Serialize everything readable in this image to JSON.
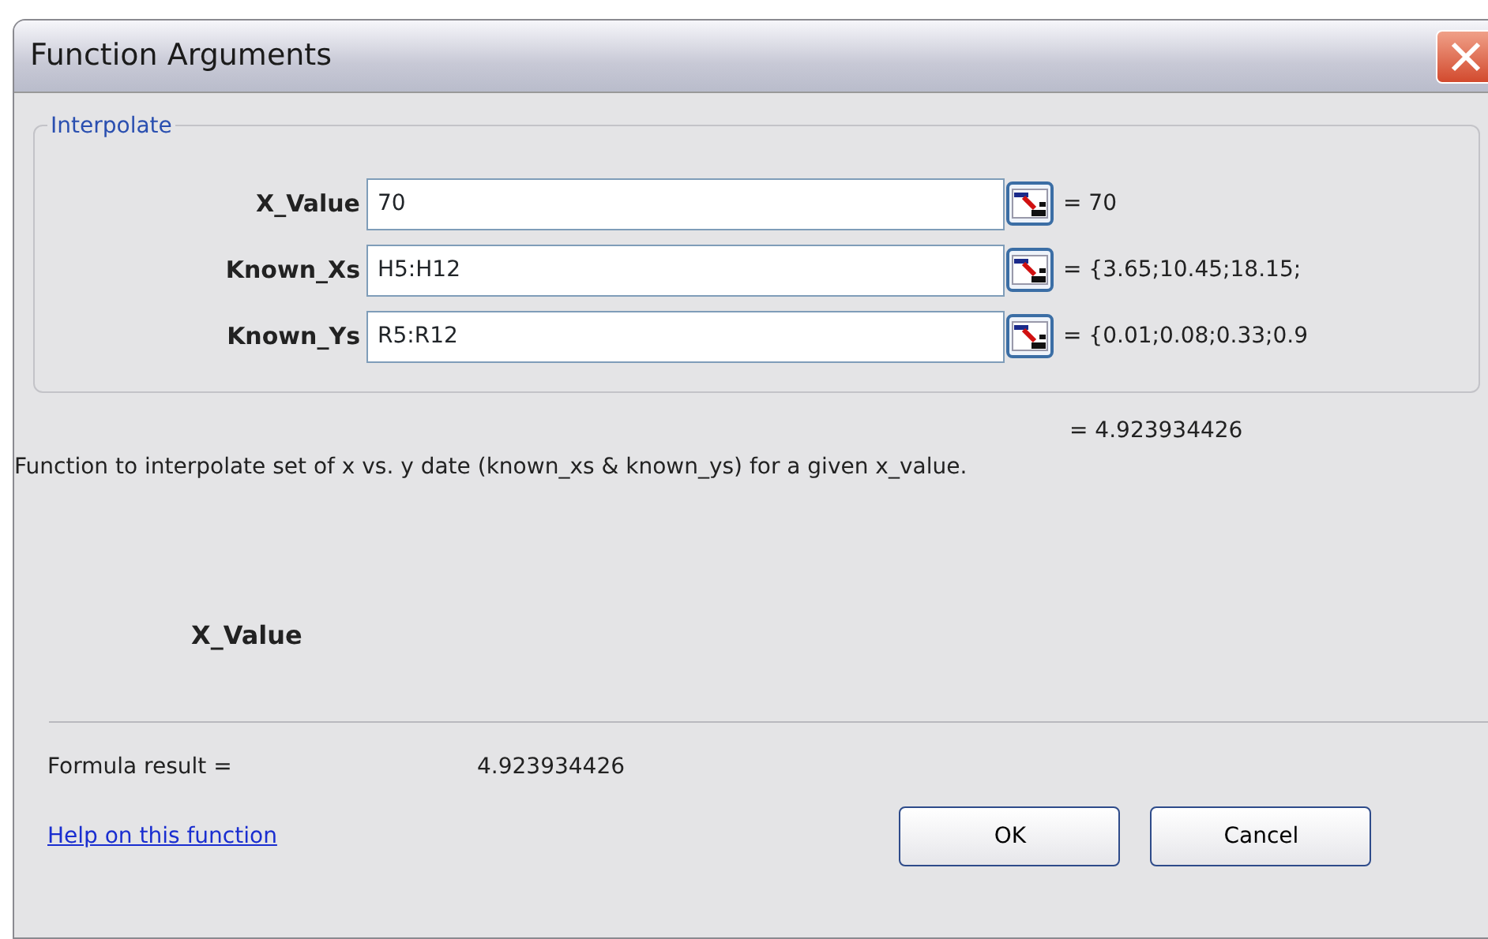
{
  "window": {
    "title": "Function Arguments"
  },
  "group": {
    "title": "Interpolate",
    "arguments": [
      {
        "label": "X_Value",
        "value": "70",
        "result": "= 70"
      },
      {
        "label": "Known_Xs",
        "value": "H5:H12",
        "result": "= {3.65;10.45;18.15;"
      },
      {
        "label": "Known_Ys",
        "value": "R5:R12",
        "result": "= {0.01;0.08;0.33;0.9"
      }
    ]
  },
  "preview_result": "= 4.923934426",
  "description": "Function to interpolate set of x vs. y date (known_xs & known_ys) for a given x_value.",
  "argument_help": {
    "name": "X_Value"
  },
  "formula_result": {
    "label": "Formula result =",
    "value": "4.923934426"
  },
  "help_link": "Help on this function",
  "buttons": [
    "OK",
    "Cancel"
  ]
}
